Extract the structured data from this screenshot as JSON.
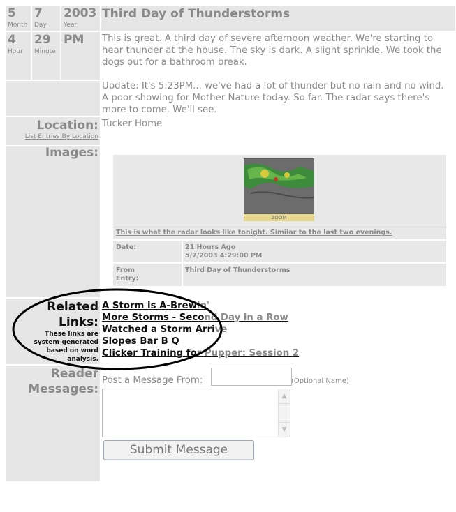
{
  "date": {
    "month": "5",
    "month_label": "Month",
    "day": "7",
    "day_label": "Day",
    "year": "2003",
    "year_label": "Year"
  },
  "time": {
    "hour": "4",
    "hour_label": "Hour",
    "minute": "29",
    "minute_label": "Minute",
    "ampm": "PM"
  },
  "entry": {
    "title": "Third Day of Thunderstorms",
    "paragraph1": "This is great. A third day of severe afternoon weather. We're starting to hear thunder at the house. The sky is dark. A slight sprinkle. We took the dogs out for a bathroom break.",
    "paragraph2": "Update: It's 5:23PM... we've had a lot of thunder but no rain and no wind. A poor showing for Mother Nature today. So far. The radar says there's more to come. We'll see."
  },
  "location": {
    "label": "Location:",
    "list_link": "List Entries By Location",
    "value": "Tucker Home"
  },
  "images": {
    "label": "Images:",
    "zoom_label": "ZOOM",
    "caption": "This is what the radar looks like tonight. Similar to the last two evenings.",
    "date_label": "Date:",
    "date_relative": "21 Hours Ago",
    "date_full": "5/7/2003 4:29:00 PM",
    "from_label_1": "From",
    "from_label_2": "Entry:",
    "from_link": "Third Day of Thunderstorms"
  },
  "related": {
    "label_1": "Related",
    "label_2": "Links:",
    "note_1": "These links are",
    "note_2": "system-generated",
    "note_3": "based on word",
    "note_4": "analysis.",
    "links": [
      {
        "a": "A Storm is A-Brew",
        "b": "in'"
      },
      {
        "a": "More Storms - Seco",
        "b": "nd Day in a Row"
      },
      {
        "a": "Watched a Storm Arri",
        "b": "ve"
      },
      {
        "a": "Slopes Bar B Q",
        "b": ""
      },
      {
        "a": "Clicker Training fo",
        "b": "r Pupper: Session 2"
      }
    ]
  },
  "messages": {
    "label_1": "Reader",
    "label_2": "Messages:",
    "post_from": "Post a Message From:",
    "name_value": "",
    "optional": "(Optional Name)",
    "message_value": "",
    "submit": "Submit Message"
  }
}
